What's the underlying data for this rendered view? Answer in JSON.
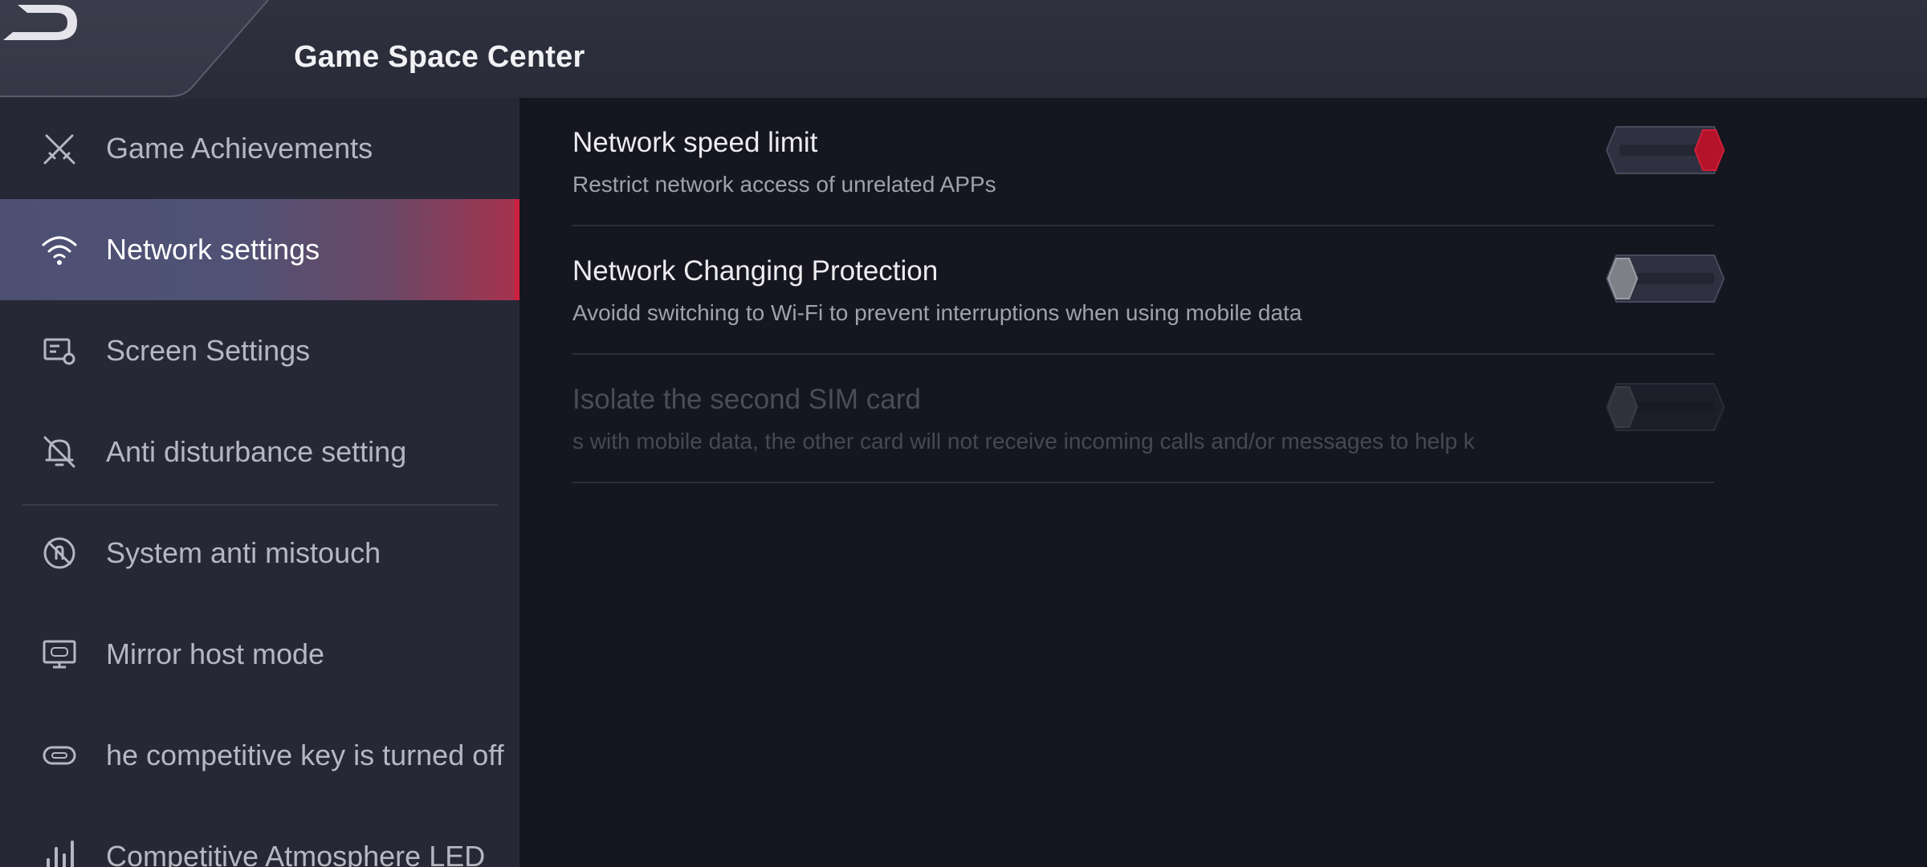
{
  "header": {
    "title": "Game Space Center",
    "back_icon": "back-arrow-icon"
  },
  "sidebar": {
    "items": [
      {
        "label": "Game Achievements",
        "icon": "crossed-swords-icon",
        "active": false
      },
      {
        "label": "Network settings",
        "icon": "wifi-icon",
        "active": true
      },
      {
        "label": "Screen Settings",
        "icon": "screen-settings-icon",
        "active": false
      },
      {
        "label": "Anti disturbance setting",
        "icon": "bell-off-icon",
        "active": false
      },
      {
        "label": "System anti mistouch",
        "icon": "touch-block-icon",
        "active": false
      },
      {
        "label": "Mirror host mode",
        "icon": "monitor-gamepad-icon",
        "active": false
      },
      {
        "label": "he competitive key is turned off",
        "icon": "key-toggle-icon",
        "active": false
      },
      {
        "label": "Competitive Atmosphere LED",
        "icon": "led-bars-icon",
        "active": false
      }
    ]
  },
  "settings": [
    {
      "title": "Network speed limit",
      "description": "Restrict network access of unrelated APPs",
      "enabled": true,
      "disabled": false
    },
    {
      "title": "Network Changing Protection",
      "description": "Avoidd switching to Wi-Fi to prevent interruptions when using mobile data",
      "enabled": false,
      "disabled": false
    },
    {
      "title": "Isolate the second SIM card",
      "description": "s with mobile data, the other card will not receive incoming calls and/or messages to help k",
      "enabled": false,
      "disabled": true
    }
  ],
  "colors": {
    "accent": "#c0182f",
    "background": "#15161f",
    "sidebar": "#262836",
    "header": "#2d2e3b"
  }
}
